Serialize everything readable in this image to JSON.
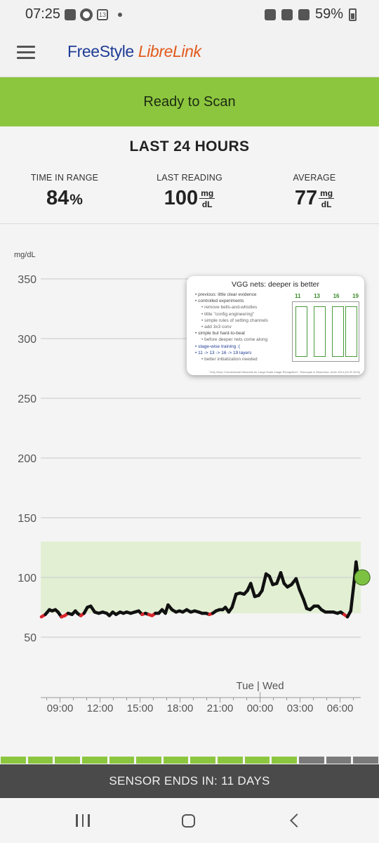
{
  "status_bar": {
    "time": "07:25",
    "calendar_day": "13",
    "battery": "59%",
    "icons": [
      "gallery-icon",
      "media-icon",
      "calendar-icon",
      "dot-icon",
      "alarm-icon",
      "wifi-icon",
      "signal-icon",
      "battery-icon"
    ]
  },
  "app": {
    "logo_part1": "FreeStyle",
    "logo_part2": "LibreLink",
    "menu_icon": "hamburger-menu-icon"
  },
  "scan_banner": {
    "label": "Ready to Scan",
    "color": "#8cc63f"
  },
  "summary": {
    "title": "LAST 24 HOURS",
    "time_in_range": {
      "label": "TIME IN RANGE",
      "value": "84",
      "unit": "%"
    },
    "last_reading": {
      "label": "LAST READING",
      "value": "100",
      "unit_top": "mg",
      "unit_bottom": "dL"
    },
    "average": {
      "label": "AVERAGE",
      "value": "77",
      "unit_top": "mg",
      "unit_bottom": "dL"
    }
  },
  "chart_data": {
    "type": "line",
    "ylabel": "mg/dL",
    "ylim": [
      0,
      350
    ],
    "y_ticks": [
      "50",
      "100",
      "150",
      "200",
      "250",
      "300",
      "350"
    ],
    "x_ticks": [
      "09:00",
      "12:00",
      "15:00",
      "18:00",
      "21:00",
      "00:00",
      "03:00",
      "06:00"
    ],
    "x_range_hours": [
      7.55,
      31.55
    ],
    "day_label": "Tue | Wed",
    "day_change_hour": 24,
    "target_range": [
      70,
      130
    ],
    "target_color": "#e2efd3",
    "line_color": "#111111",
    "low_color": "#d9262b",
    "low_threshold": 70,
    "current_reading": {
      "hour": 31.35,
      "value": 100,
      "color": "#7dc142"
    },
    "series": [
      {
        "hour": 7.6,
        "value": 67
      },
      {
        "hour": 7.9,
        "value": 69
      },
      {
        "hour": 8.2,
        "value": 73
      },
      {
        "hour": 8.4,
        "value": 72
      },
      {
        "hour": 8.65,
        "value": 73
      },
      {
        "hour": 8.85,
        "value": 71
      },
      {
        "hour": 9.1,
        "value": 67
      },
      {
        "hour": 9.35,
        "value": 68
      },
      {
        "hour": 9.6,
        "value": 70
      },
      {
        "hour": 9.9,
        "value": 69
      },
      {
        "hour": 10.15,
        "value": 72
      },
      {
        "hour": 10.3,
        "value": 70
      },
      {
        "hour": 10.55,
        "value": 68
      },
      {
        "hour": 10.8,
        "value": 70
      },
      {
        "hour": 11.05,
        "value": 75
      },
      {
        "hour": 11.3,
        "value": 76
      },
      {
        "hour": 11.6,
        "value": 71
      },
      {
        "hour": 11.9,
        "value": 70
      },
      {
        "hour": 12.2,
        "value": 71
      },
      {
        "hour": 12.5,
        "value": 70
      },
      {
        "hour": 12.7,
        "value": 68
      },
      {
        "hour": 12.95,
        "value": 71
      },
      {
        "hour": 13.2,
        "value": 69
      },
      {
        "hour": 13.5,
        "value": 71
      },
      {
        "hour": 13.75,
        "value": 70
      },
      {
        "hour": 14.0,
        "value": 71
      },
      {
        "hour": 14.3,
        "value": 70
      },
      {
        "hour": 14.6,
        "value": 71
      },
      {
        "hour": 14.9,
        "value": 72
      },
      {
        "hour": 15.15,
        "value": 69
      },
      {
        "hour": 15.4,
        "value": 70
      },
      {
        "hour": 15.65,
        "value": 69
      },
      {
        "hour": 15.9,
        "value": 68
      },
      {
        "hour": 16.15,
        "value": 70
      },
      {
        "hour": 16.4,
        "value": 70
      },
      {
        "hour": 16.65,
        "value": 73
      },
      {
        "hour": 16.9,
        "value": 70
      },
      {
        "hour": 17.1,
        "value": 77
      },
      {
        "hour": 17.4,
        "value": 73
      },
      {
        "hour": 17.7,
        "value": 71
      },
      {
        "hour": 17.95,
        "value": 72
      },
      {
        "hour": 18.2,
        "value": 71
      },
      {
        "hour": 18.5,
        "value": 73
      },
      {
        "hour": 18.8,
        "value": 71
      },
      {
        "hour": 19.1,
        "value": 72
      },
      {
        "hour": 19.4,
        "value": 71
      },
      {
        "hour": 19.65,
        "value": 70
      },
      {
        "hour": 19.95,
        "value": 70
      },
      {
        "hour": 20.2,
        "value": 69
      },
      {
        "hour": 20.45,
        "value": 70
      },
      {
        "hour": 20.7,
        "value": 72
      },
      {
        "hour": 20.95,
        "value": 73
      },
      {
        "hour": 21.2,
        "value": 73
      },
      {
        "hour": 21.4,
        "value": 75
      },
      {
        "hour": 21.65,
        "value": 71
      },
      {
        "hour": 21.9,
        "value": 75
      },
      {
        "hour": 22.2,
        "value": 86
      },
      {
        "hour": 22.5,
        "value": 87
      },
      {
        "hour": 22.8,
        "value": 86
      },
      {
        "hour": 23.05,
        "value": 89
      },
      {
        "hour": 23.3,
        "value": 95
      },
      {
        "hour": 23.6,
        "value": 84
      },
      {
        "hour": 23.9,
        "value": 85
      },
      {
        "hour": 24.15,
        "value": 89
      },
      {
        "hour": 24.45,
        "value": 103
      },
      {
        "hour": 24.7,
        "value": 101
      },
      {
        "hour": 24.95,
        "value": 94
      },
      {
        "hour": 25.25,
        "value": 95
      },
      {
        "hour": 25.55,
        "value": 104
      },
      {
        "hour": 25.8,
        "value": 95
      },
      {
        "hour": 26.05,
        "value": 92
      },
      {
        "hour": 26.35,
        "value": 94
      },
      {
        "hour": 26.7,
        "value": 99
      },
      {
        "hour": 26.95,
        "value": 90
      },
      {
        "hour": 27.25,
        "value": 82
      },
      {
        "hour": 27.5,
        "value": 74
      },
      {
        "hour": 27.75,
        "value": 73
      },
      {
        "hour": 28.05,
        "value": 76
      },
      {
        "hour": 28.35,
        "value": 76
      },
      {
        "hour": 28.6,
        "value": 73
      },
      {
        "hour": 28.9,
        "value": 71
      },
      {
        "hour": 29.2,
        "value": 71
      },
      {
        "hour": 29.5,
        "value": 71
      },
      {
        "hour": 29.8,
        "value": 70
      },
      {
        "hour": 30.05,
        "value": 71
      },
      {
        "hour": 30.3,
        "value": 69
      },
      {
        "hour": 30.55,
        "value": 67
      },
      {
        "hour": 30.8,
        "value": 72
      },
      {
        "hour": 31.05,
        "value": 96
      },
      {
        "hour": 31.2,
        "value": 113
      },
      {
        "hour": 31.35,
        "value": 100
      }
    ]
  },
  "overlay": {
    "title": "VGG nets: deeper is better",
    "items": [
      {
        "text": "previous: little clear evidence",
        "kind": "main"
      },
      {
        "text": "controlled experiments",
        "kind": "main"
      },
      {
        "text": "remove bells-and-whistles",
        "kind": "sub"
      },
      {
        "text": "little \"config engineering\"",
        "kind": "sub"
      },
      {
        "text": "simple rules of setting channels",
        "kind": "sub"
      },
      {
        "text": "add 3x3 conv",
        "kind": "sub"
      },
      {
        "text": "simple but hard-to-beat",
        "kind": "main"
      },
      {
        "text": "before deeper nets come along",
        "kind": "sub"
      },
      {
        "text": "stage-wise training :(",
        "kind": "hl"
      },
      {
        "text": "11 -> 13 -> 16 -> 19 layers",
        "kind": "hl"
      },
      {
        "text": "better initialization needed",
        "kind": "sub"
      }
    ],
    "column_numbers": [
      "11",
      "13",
      "16",
      "19"
    ],
    "citation": "\"Very Deep Convolutional Networks for Large-Scale Image Recognition\". Simonyan & Zisserman. arXiv 2014 (ICLR 2015)"
  },
  "sensor": {
    "label": "SENSOR ENDS IN: 11 DAYS",
    "segments_total": 14,
    "segments_used": 11,
    "color_used": "#8cc63f",
    "color_unused": "#7a7a7a"
  },
  "navbar": {
    "recent_icon": "recent-apps-icon",
    "home_icon": "home-icon",
    "back_icon": "back-icon"
  }
}
